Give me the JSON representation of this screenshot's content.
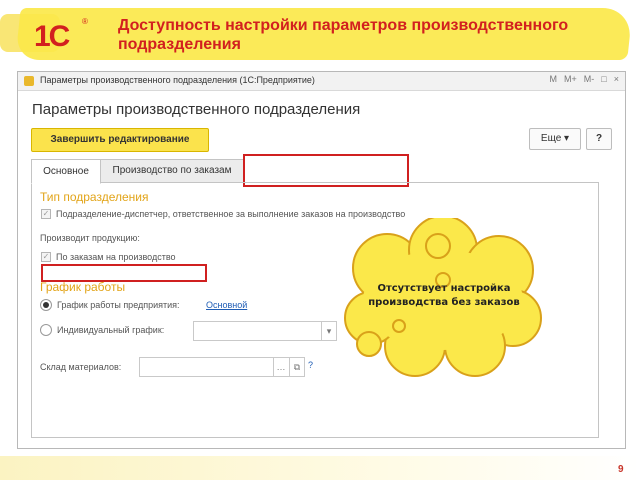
{
  "slide": {
    "logo": "1C",
    "logo_mark": "®",
    "title": "Доступность настройки параметров производственного подразделения",
    "page_number": "9"
  },
  "window": {
    "title": "Параметры производственного подразделения  (1С:Предприятие)",
    "controls": [
      "M",
      "M+",
      "M-",
      "□",
      "×"
    ]
  },
  "form": {
    "heading": "Параметры производственного подразделения",
    "finish_button": "Завершить редактирование",
    "more_button": "Еще ▾",
    "help_button": "?",
    "tabs": [
      "Основное",
      "Производство по заказам"
    ],
    "section_type": "Тип подразделения",
    "checkbox_dispatcher": "Подразделение-диспетчер, ответственное за выполнение заказов на производство",
    "produces_label": "Производит продукцию:",
    "checkbox_orders": "По заказам на производство",
    "section_schedule": "График работы",
    "radio_enterprise": "График работы предприятия:",
    "enterprise_link": "Основной",
    "radio_individual": "Индивидуальный график:",
    "warehouse_label": "Склад материалов:",
    "warehouse_help": "?"
  },
  "callout": {
    "text": "Отсутствует настройка производства без заказов"
  },
  "colors": {
    "title_red": "#d2201f",
    "banner_yellow": "#fbe84a",
    "section_orange": "#e2a418",
    "highlight_red": "#d02020"
  }
}
